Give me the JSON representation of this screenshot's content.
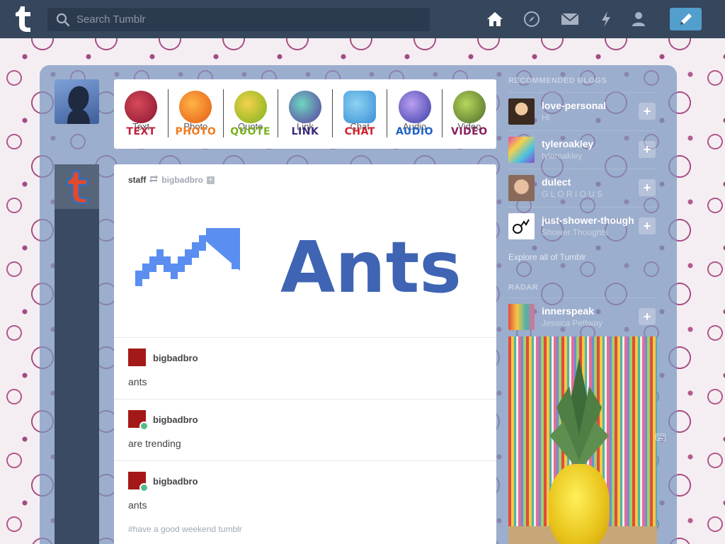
{
  "topbar": {
    "logo_icon": "tumblr-logo",
    "search_placeholder": "Search Tumblr",
    "nav_icons": [
      "home-icon",
      "explore-icon",
      "inbox-icon",
      "activity-icon",
      "account-icon"
    ],
    "compose_icon": "pencil-icon"
  },
  "post_types": [
    {
      "label": "Text",
      "big": "TEXT",
      "color": "#c0203b"
    },
    {
      "label": "Photo",
      "big": "PHOTO",
      "color": "#f07b1d"
    },
    {
      "label": "Quote",
      "big": "QUOTE",
      "color": "#79b21d"
    },
    {
      "label": "Link",
      "big": "LINK",
      "color": "#3b2a7a"
    },
    {
      "label": "Chat",
      "big": "CHAT",
      "color": "#d31f2b"
    },
    {
      "label": "Audio",
      "big": "AUDIO",
      "color": "#1f62c9"
    },
    {
      "label": "Video",
      "big": "VIDEO",
      "color": "#8a1e5d"
    }
  ],
  "post": {
    "author": "staff",
    "reblogged_from": "bigbadbro",
    "image_text": "Ants",
    "reblogs": [
      {
        "name": "bigbadbro",
        "text": "ants"
      },
      {
        "name": "bigbadbro",
        "text": "are trending"
      },
      {
        "name": "bigbadbro",
        "text": "ants"
      }
    ],
    "tags": "#have a good weekend tumblr"
  },
  "sidebar": {
    "recommended_heading": "RECOMMENDED BLOGS",
    "recommended": [
      {
        "name": "love-personal",
        "sub": "Hi"
      },
      {
        "name": "tyleroakley",
        "sub": "tyleroakley"
      },
      {
        "name": "dulect",
        "sub": "G L O R I O U S"
      },
      {
        "name": "just-shower-thoughts",
        "sub": "Shower Thoughts"
      }
    ],
    "explore_link": "Explore all of Tumblr",
    "radar_heading": "RADAR",
    "radar": {
      "name": "innerspeak",
      "sub": "Jessica Pettway"
    }
  }
}
